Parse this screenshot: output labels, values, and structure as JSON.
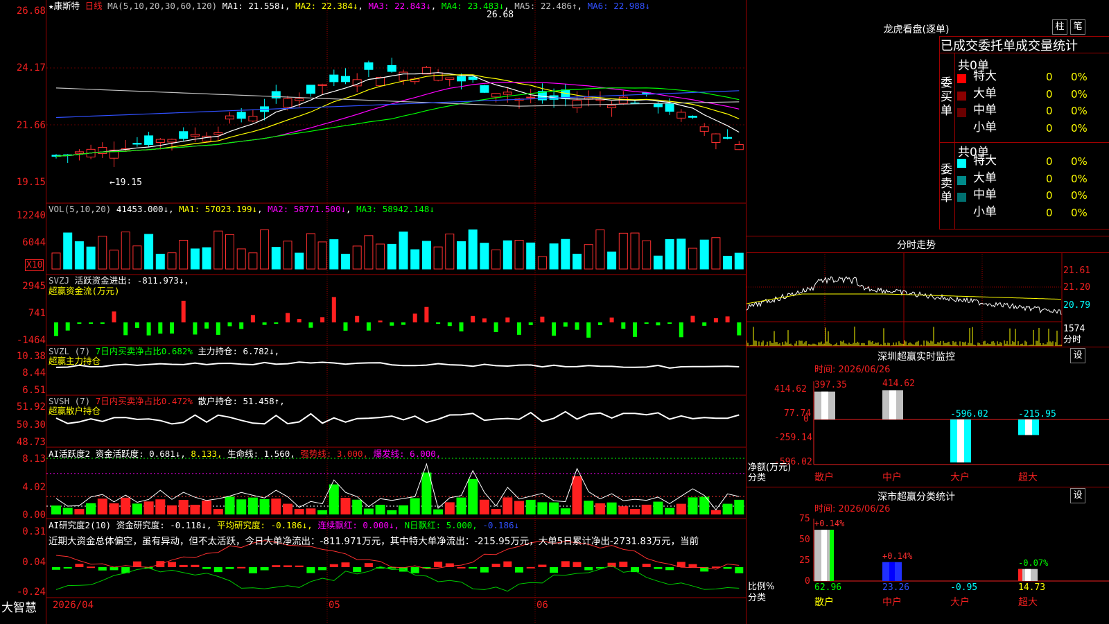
{
  "app": {
    "brand": "大智慧"
  },
  "stock": {
    "name": "康斯特",
    "period": "日线"
  },
  "main_chart": {
    "ma_title": "MA(5,10,20,30,60,120)",
    "ma1": "MA1: 21.558↓",
    "ma2": "MA2: 22.384↓",
    "ma3": "MA3: 22.843↓",
    "ma4": "MA4: 23.483↓",
    "ma5": "MA5: 22.486↑",
    "ma6": "MA6: 22.988↓",
    "high_label": "26.68",
    "low_label": "←19.15",
    "axis": [
      "26.68",
      "24.17",
      "21.66",
      "19.15"
    ],
    "colors": {
      "ma1": "#ffffff",
      "ma2": "#ffff00",
      "ma3": "#ff00ff",
      "ma4": "#00ff00",
      "ma5": "#c0c0c0",
      "ma6": "#0000ff"
    }
  },
  "vol": {
    "title": "VOL(5,10,20)",
    "value": "41453.000↓",
    "ma1": "MA1: 57023.199↓",
    "ma2": "MA2: 58771.500↓",
    "ma3": "MA3: 58942.148↓",
    "axis": [
      "12240",
      "6044"
    ],
    "unit": "X10"
  },
  "svzj": {
    "title": "SVZJ",
    "label": "活跃资金进出: -811.973↓,",
    "subtitle": "超赢资金流(万元)",
    "axis": [
      "2945",
      "741",
      "-1464"
    ]
  },
  "svzl": {
    "title": "SVZL (7)",
    "label1": "7日内买卖净占比0.682%",
    "label2": "主力持仓: 6.782↓,",
    "subtitle": "超赢主力持仓",
    "axis": [
      "10.38",
      "8.44",
      "6.51"
    ]
  },
  "svsh": {
    "title": "SVSH (7)",
    "label1": "7日内买卖净占比0.472%",
    "label2": "散户持仓: 51.458↑,",
    "subtitle": "超赢散户持仓",
    "axis": [
      "51.92",
      "50.30",
      "48.73"
    ]
  },
  "ai2": {
    "title": "AI活跃度2",
    "label": "资金活跃度: 0.681↓,",
    "v2": "8.133,",
    "life": "生命线: 1.560,",
    "strong": "强势线: 3.000,",
    "burst": "爆发线: 6.000,",
    "axis": [
      "8.13",
      "4.02",
      "0.00"
    ]
  },
  "ai_research": {
    "title": "AI研究度2(10)",
    "label": "资金研究度: -0.118↓,",
    "avg": "平均研究度: -0.186↓,",
    "cont": "连续飘红: 0.000↓,",
    "nday": "N日飘红: 5.000,",
    "last": "-0.186↓",
    "comment": "近期大资金总体偏空，虽有异动，但不太活跃，今日大单净流出：-811.971万元，其中特大单净流出：-215.95万元，大单5日累计净出-2731.83万元，当前",
    "axis": [
      "0.31",
      "0.04",
      "-0.24"
    ]
  },
  "x_axis": {
    "dates": [
      "2026/04",
      "05",
      "06"
    ]
  },
  "right": {
    "lhb": {
      "title": "龙虎看盘(逐单)",
      "btn1": "柱",
      "btn2": "笔",
      "subtitle": "已成交委托单成交量统计",
      "buy": {
        "label": "委买单",
        "total": "共0单",
        "rows": [
          {
            "name": "特大",
            "v": "0",
            "p": "0%"
          },
          {
            "name": "大单",
            "v": "0",
            "p": "0%"
          },
          {
            "name": "中单",
            "v": "0",
            "p": "0%"
          },
          {
            "name": "小单",
            "v": "0",
            "p": "0%"
          }
        ]
      },
      "sell": {
        "label": "委卖单",
        "total": "共0单",
        "rows": [
          {
            "name": "特大",
            "v": "0",
            "p": "0%"
          },
          {
            "name": "大单",
            "v": "0",
            "p": "0%"
          },
          {
            "name": "中单",
            "v": "0",
            "p": "0%"
          },
          {
            "name": "小单",
            "v": "0",
            "p": "0%"
          }
        ]
      }
    },
    "intraday": {
      "title": "分时走势",
      "axis": [
        "21.61",
        "21.20",
        "20.79"
      ],
      "vol": "1574",
      "unit": "分时"
    },
    "monitor": {
      "title": "深圳超赢实时监控",
      "btn": "设",
      "time": "时间: 2026/06/26",
      "axis": [
        "414.62",
        "77.74",
        "0",
        "-259.14",
        "-596.02"
      ],
      "ylabel": "净额(万元)",
      "xlabel": "分类",
      "cats": [
        "散户",
        "中户",
        "大户",
        "超大"
      ],
      "values": [
        "397.35",
        "414.62",
        "-596.02",
        "-215.95"
      ],
      "chart_data": {
        "type": "bar",
        "categories": [
          "散户",
          "中户",
          "大户",
          "超大"
        ],
        "values": [
          397.35,
          414.62,
          -596.02,
          -215.95
        ],
        "ylabel": "净额(万元)",
        "ylim": [
          -596.02,
          414.62
        ]
      }
    },
    "stats": {
      "title": "深市超赢分类统计",
      "btn": "设",
      "time": "时间: 2026/06/26",
      "axis": [
        "75",
        "50",
        "25",
        "0"
      ],
      "ylabel": "比例%",
      "xlabel": "分类",
      "cats": [
        "散户",
        "中户",
        "大户",
        "超大"
      ],
      "top": [
        "+0.14%",
        "+0.14%",
        "",
        "-0.07%"
      ],
      "bottom": [
        "62.96",
        "23.26",
        "-0.95",
        "14.73"
      ],
      "chart_data": {
        "type": "bar",
        "categories": [
          "散户",
          "中户",
          "大户",
          "超大"
        ],
        "values": [
          62.96,
          23.26,
          -0.95,
          14.73
        ],
        "ylabel": "比例%",
        "ylim": [
          0,
          75
        ]
      }
    }
  }
}
